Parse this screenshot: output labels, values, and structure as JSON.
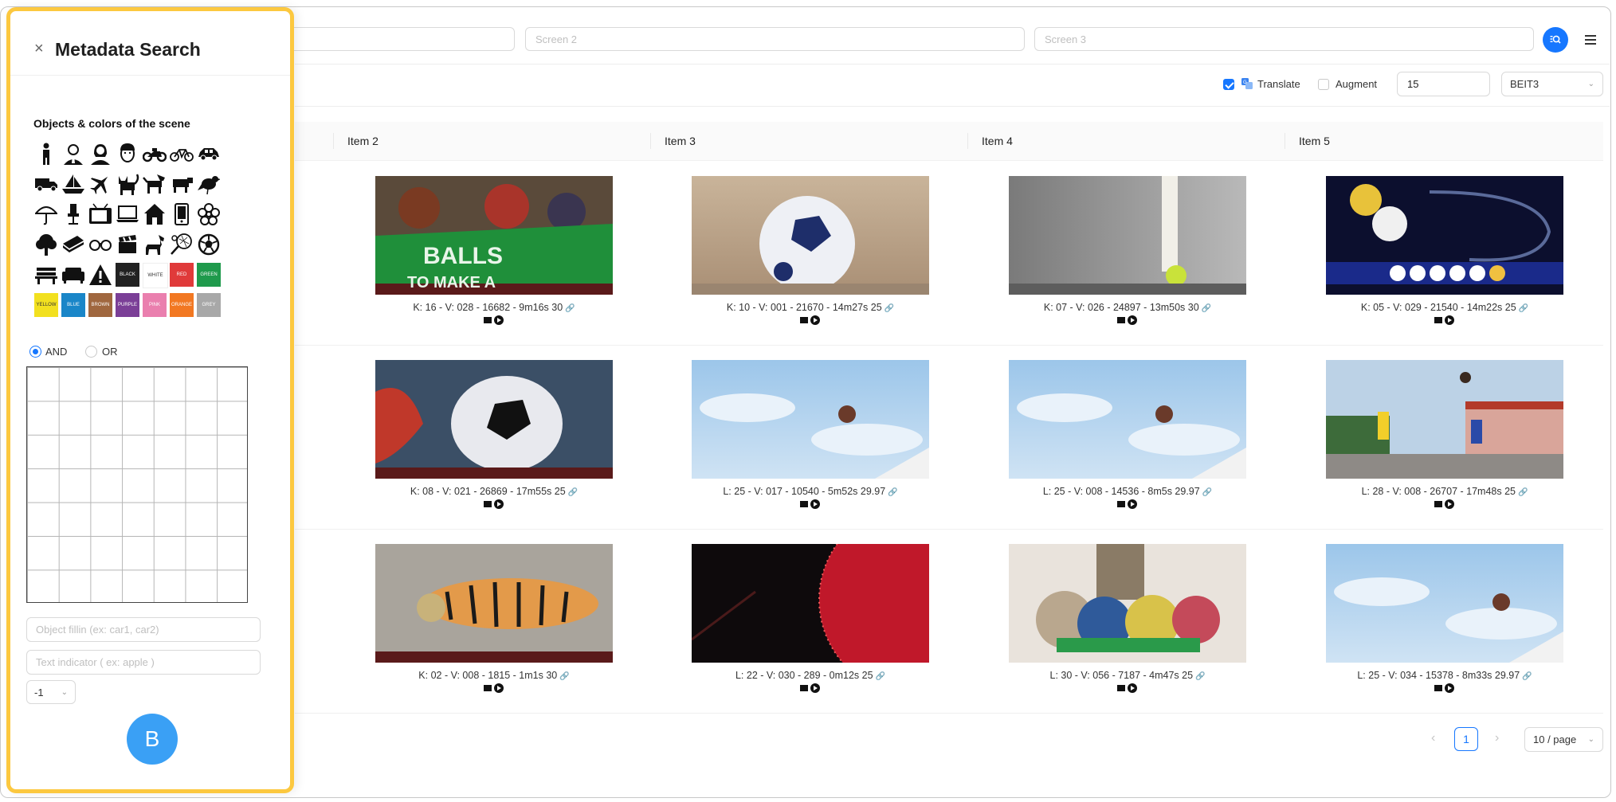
{
  "topbar": {
    "screen_placeholders": [
      "",
      "Screen 2",
      "Screen 3"
    ],
    "search_button_icon": "image-search-icon",
    "menu_icon": "hamburger-menu-icon"
  },
  "options": {
    "translate": {
      "label": "Translate",
      "checked": true,
      "icon": "translate-icon"
    },
    "augment": {
      "label": "Augment",
      "checked": false
    },
    "result_count": "15",
    "model": "BEIT3"
  },
  "table": {
    "columns": [
      "Item 2",
      "Item 3",
      "Item 4",
      "Item 5"
    ],
    "rows": [
      [
        {
          "caption": "K: 16 - V: 028 - 16682 - 9m16s 30",
          "thumb": "balls-banner"
        },
        {
          "caption": "K: 10 - V: 001 - 21670 - 14m27s 25",
          "thumb": "soccer-sand"
        },
        {
          "caption": "K: 07 - V: 026 - 24897 - 13m50s 30",
          "thumb": "tennis-ball"
        },
        {
          "caption": "K: 05 - V: 029 - 21540 - 14m22s 25",
          "thumb": "lottery"
        }
      ],
      [
        {
          "caption": "K: 08 - V: 021 - 26869 - 17m55s 25",
          "thumb": "soccer-ball"
        },
        {
          "caption": "L: 25 - V: 017 - 10540 - 5m52s 29.97",
          "thumb": "sky-ball"
        },
        {
          "caption": "L: 25 - V: 008 - 14536 - 8m5s 29.97",
          "thumb": "sky-ball"
        },
        {
          "caption": "L: 28 - V: 008 - 26707 - 17m48s 25",
          "thumb": "kids-football"
        }
      ],
      [
        {
          "caption": "K: 02 - V: 008 - 1815 - 1m1s 30",
          "thumb": "tiger"
        },
        {
          "caption": "L: 22 - V: 030 - 289 - 0m12s 25",
          "thumb": "red-dark"
        },
        {
          "caption": "L: 30 - V: 056 - 7187 - 4m47s 25",
          "thumb": "knit-balls"
        },
        {
          "caption": "L: 25 - V: 034 - 15378 - 8m33s 29.97",
          "thumb": "sky-ball"
        }
      ]
    ]
  },
  "pagination": {
    "current": "1",
    "page_size": "10 / page"
  },
  "drawer": {
    "title": "Metadata Search",
    "objects_label": "Objects & colors of the scene",
    "object_icons": [
      "person-icon",
      "man-icon",
      "woman-icon",
      "face-icon",
      "motorbike-icon",
      "bicycle-icon",
      "car-icon",
      "truck-icon",
      "boat-icon",
      "airplane-icon",
      "cat-icon",
      "dog-icon",
      "cow-icon",
      "bird-icon",
      "umbrella-icon",
      "chair-icon",
      "tv-icon",
      "laptop-icon",
      "house-icon",
      "phone-icon",
      "flower-icon",
      "tree-icon",
      "book-icon",
      "glasses-icon",
      "clapperboard-icon",
      "horse-icon",
      "tennis-racket-icon",
      "soccer-ball-icon",
      "bench-icon",
      "sofa-icon",
      "warning-icon"
    ],
    "colors": [
      {
        "name": "BLACK",
        "hex": "#222222",
        "text": "#ffffff"
      },
      {
        "name": "WHITE",
        "hex": "#ffffff",
        "text": "#333333"
      },
      {
        "name": "RED",
        "hex": "#e03a3a",
        "text": "#ffffff"
      },
      {
        "name": "GREEN",
        "hex": "#1f9a4c",
        "text": "#ffffff"
      },
      {
        "name": "YELLOW",
        "hex": "#f2e01f",
        "text": "#333333"
      },
      {
        "name": "BLUE",
        "hex": "#1a86c8",
        "text": "#ffffff"
      },
      {
        "name": "BROWN",
        "hex": "#a0673f",
        "text": "#ffffff"
      },
      {
        "name": "PURPLE",
        "hex": "#7b3f97",
        "text": "#ffffff"
      },
      {
        "name": "PINK",
        "hex": "#ea7fae",
        "text": "#ffffff"
      },
      {
        "name": "ORANGE",
        "hex": "#f27822",
        "text": "#ffffff"
      },
      {
        "name": "GREY",
        "hex": "#a8a8a8",
        "text": "#ffffff"
      }
    ],
    "logic": {
      "and_label": "AND",
      "or_label": "OR",
      "selected": "AND"
    },
    "object_fill_placeholder": "Object fillin (ex: car1, car2)",
    "text_indicator_placeholder": "Text indicator ( ex: apple )",
    "select_value": "-1",
    "badge": "B"
  }
}
